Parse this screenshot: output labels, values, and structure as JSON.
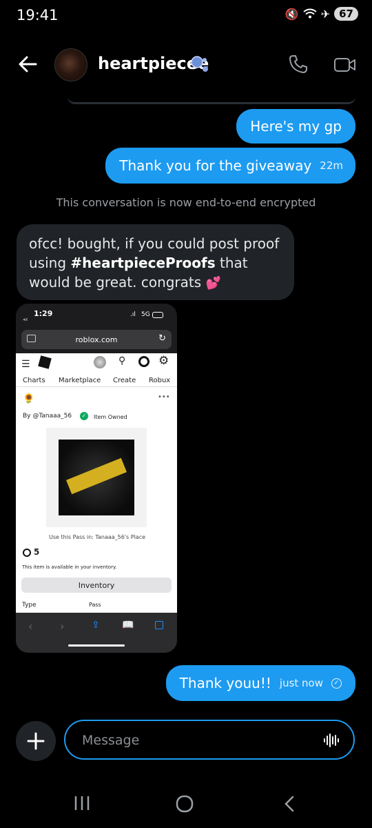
{
  "status_bar": {
    "time": "19:41",
    "battery": "67"
  },
  "header": {
    "contact_name": "heartpiecee"
  },
  "messages": {
    "out1": "Here's my gp",
    "out2": "Thank you for the giveaway",
    "out2_time": "22m",
    "encryption_notice": "This conversation is now end-to-end encrypted",
    "in1_part1": "ofcc! bought, if you could post proof using ",
    "in1_hashtag": "#heartpieceProofs",
    "in1_part2": " that would be great. congrats ",
    "out3": "Thank youu!!",
    "out3_time": "just now"
  },
  "attachment": {
    "time": "1:29",
    "network": "5G",
    "url": "roblox.com",
    "tabs": [
      "Charts",
      "Marketplace",
      "Create",
      "Robux"
    ],
    "by_label": "By @Tanaaa_56",
    "owned_label": "Item Owned",
    "use_pass": "Use this Pass in: Tanaaa_56's Place",
    "price": "5",
    "available": "This item is available in your inventory.",
    "inventory_button": "Inventory",
    "type_label": "Type",
    "type_value": "Pass"
  },
  "composer": {
    "placeholder": "Message"
  },
  "colors": {
    "accent": "#1d9bf0",
    "incoming_bubble": "#202327",
    "background": "#000000"
  }
}
